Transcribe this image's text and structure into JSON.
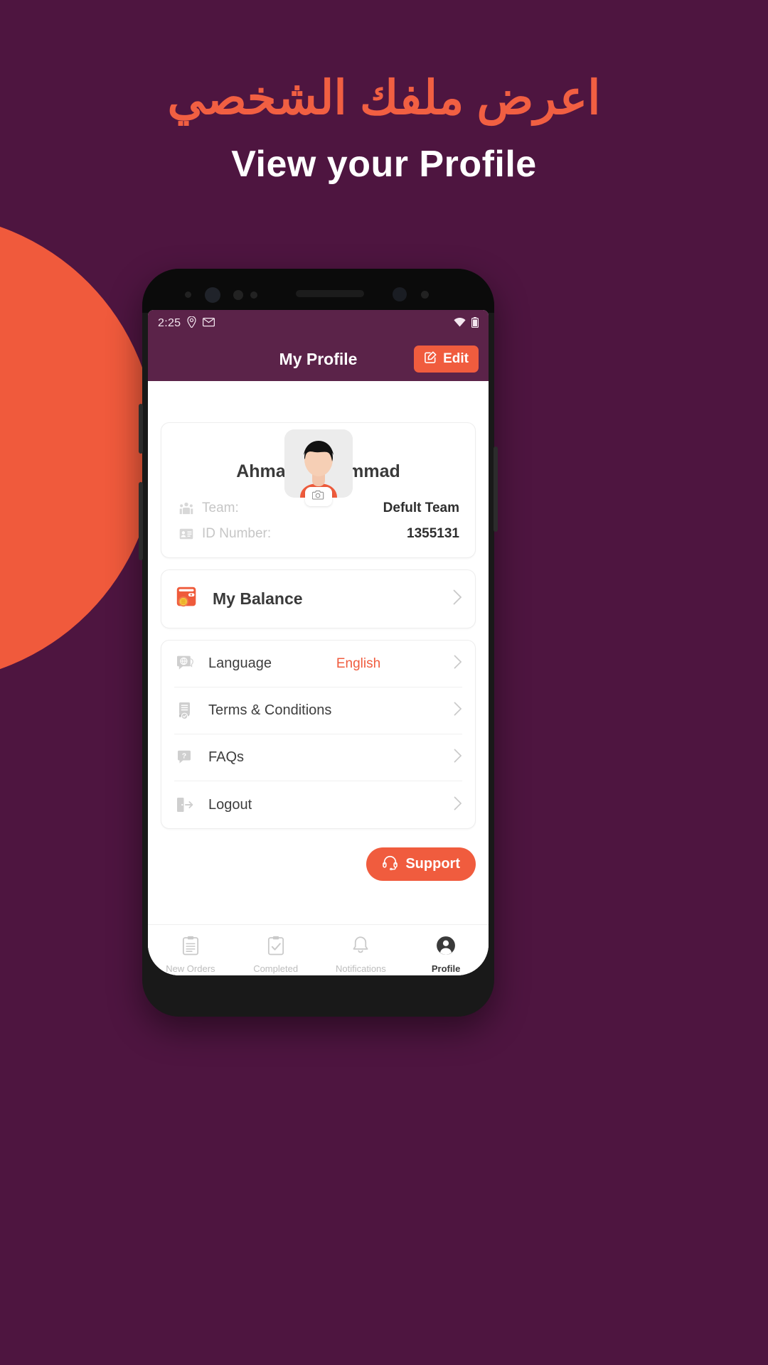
{
  "promo": {
    "arabic_heading": "اعرض ملفك الشخصي",
    "english_heading": "View your Profile",
    "accent_color": "#F15F42",
    "background_color": "#4E1540"
  },
  "statusbar": {
    "time": "2:25",
    "icons": [
      "location-pin-icon",
      "gmail-icon",
      "wifi-icon",
      "battery-icon"
    ]
  },
  "appbar": {
    "title": "My Profile",
    "edit_label": "Edit",
    "edit_icon": "edit-pencil-icon",
    "background_color": "#5B2349",
    "accent_color": "#F05C3E"
  },
  "profile": {
    "avatar_icon": "user-avatar-image",
    "camera_badge_icon": "camera-icon",
    "name": "Ahmad Mohammad",
    "fields": [
      {
        "icon": "team-group-icon",
        "label": "Team:",
        "value": "Defult Team"
      },
      {
        "icon": "id-card-icon",
        "label": "ID Number:",
        "value": "1355131"
      }
    ]
  },
  "balance": {
    "icon": "wallet-icon",
    "label": "My Balance",
    "chevron_icon": "chevron-right-icon"
  },
  "menu": [
    {
      "icon": "language-globe-icon",
      "label": "Language",
      "value": "English",
      "chevron_icon": "chevron-right-icon"
    },
    {
      "icon": "terms-document-icon",
      "label": "Terms & Conditions",
      "value": "",
      "chevron_icon": "chevron-right-icon"
    },
    {
      "icon": "faq-question-icon",
      "label": "FAQs",
      "value": "",
      "chevron_icon": "chevron-right-icon"
    },
    {
      "icon": "logout-door-icon",
      "label": "Logout",
      "value": "",
      "chevron_icon": "chevron-right-icon"
    }
  ],
  "support": {
    "label": "Support",
    "icon": "headset-icon"
  },
  "bottomnav": {
    "items": [
      {
        "icon": "clipboard-list-icon",
        "label": "New Orders",
        "active": false
      },
      {
        "icon": "clipboard-check-icon",
        "label": "Completed",
        "active": false
      },
      {
        "icon": "bell-icon",
        "label": "Notifications",
        "active": false
      },
      {
        "icon": "profile-person-icon",
        "label": "Profile",
        "active": true
      }
    ]
  }
}
